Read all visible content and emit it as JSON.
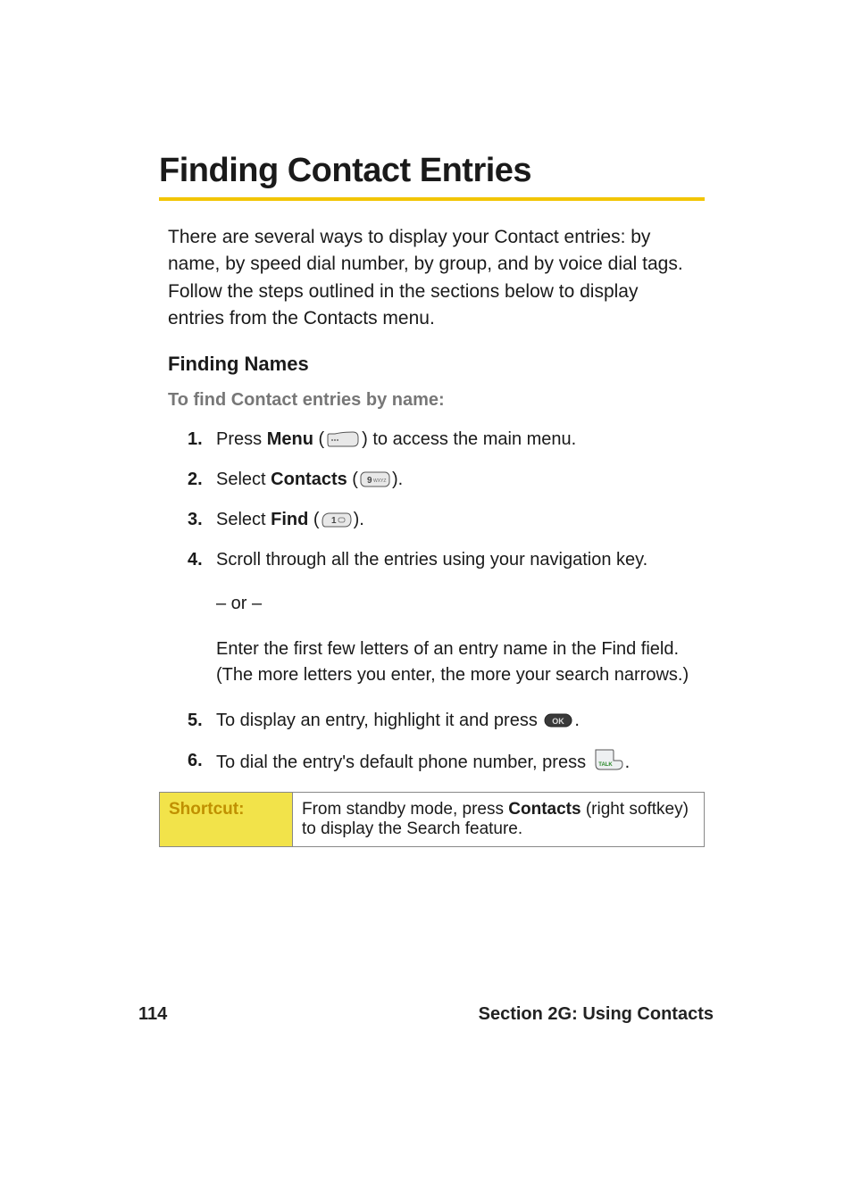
{
  "title": "Finding Contact Entries",
  "intro": "There are several ways to display your Contact entries: by name, by speed dial number, by group, and by voice dial tags. Follow the steps outlined in the sections below to display entries from the Contacts menu.",
  "subheading": "Finding Names",
  "lead": "To find Contact entries by name:",
  "steps": {
    "s1": {
      "num": "1.",
      "pre": "Press ",
      "bold": "Menu",
      "mid": " (",
      "post": ") to access the main menu."
    },
    "s2": {
      "num": "2.",
      "pre": "Select ",
      "bold": "Contacts",
      "mid": " (",
      "post": ")."
    },
    "s3": {
      "num": "3.",
      "pre": "Select ",
      "bold": "Find",
      "mid": " (",
      "post": ")."
    },
    "s4": {
      "num": "4.",
      "text": "Scroll through all the entries using your navigation key."
    },
    "s4or": "– or –",
    "s4alt": "Enter the first few letters of an entry name in the Find field. (The more letters you enter, the more your search narrows.)",
    "s5": {
      "num": "5.",
      "pre": "To display an entry, highlight it and press ",
      "post": "."
    },
    "s6": {
      "num": "6.",
      "pre": "To dial the entry's default phone number, press ",
      "post": "."
    }
  },
  "shortcut": {
    "label": "Shortcut:",
    "pre": "From standby mode, press ",
    "bold": "Contacts",
    "post": " (right softkey) to display the Search feature."
  },
  "footer": {
    "page": "114",
    "section": "Section 2G: Using Contacts"
  }
}
